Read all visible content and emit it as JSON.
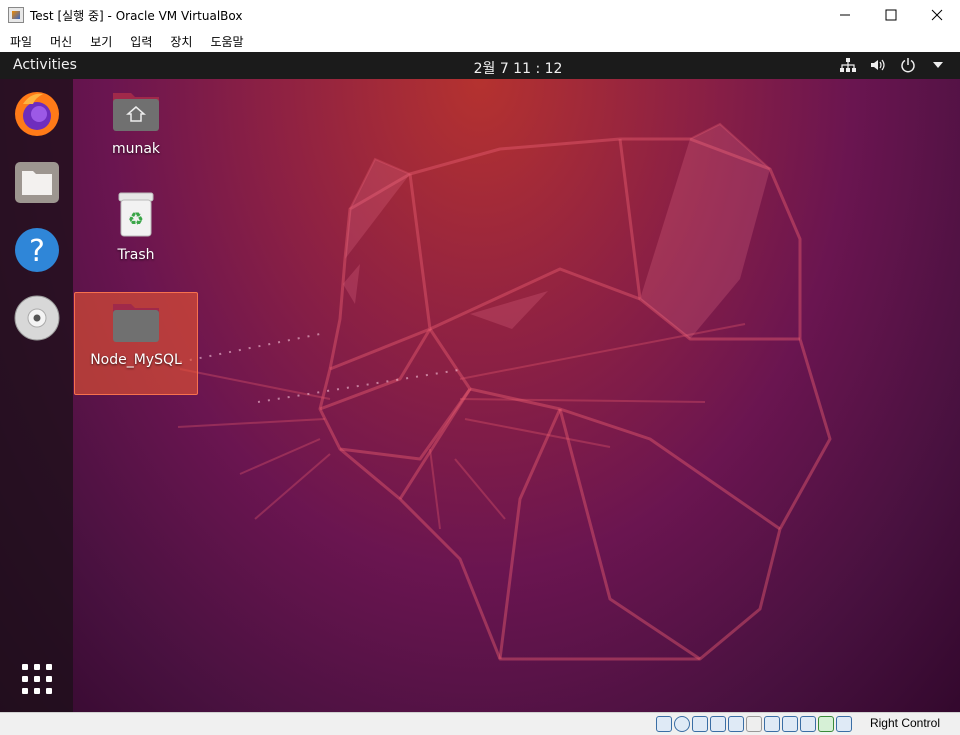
{
  "window": {
    "title": "Test [실행 중] - Oracle VM VirtualBox",
    "controls": [
      "minimize-icon",
      "maximize-icon",
      "close-icon"
    ]
  },
  "menu": [
    "파일",
    "머신",
    "보기",
    "입력",
    "장치",
    "도움말"
  ],
  "guest": {
    "topbar": {
      "activities": "Activities",
      "clock": "2월 7  11 : 12",
      "tray_icons": [
        "network-icon",
        "volume-icon",
        "power-icon",
        "chevron-down-icon"
      ]
    },
    "dock": [
      "firefox-icon",
      "files-icon",
      "help-icon",
      "disc-icon",
      "app-grid-icon"
    ],
    "desktop_icons": [
      {
        "label": "munak",
        "icon": "home-folder-icon"
      },
      {
        "label": "Trash",
        "icon": "trash-icon"
      },
      {
        "label": "Node_MySQL",
        "icon": "folder-icon",
        "selected": true
      }
    ]
  },
  "statusbar": {
    "host_key": "Right Control",
    "icons": [
      "hard-disk-icon",
      "optical-drive-icon",
      "audio-icon",
      "network-adapter-icon",
      "usb-icon",
      "shared-folder-icon",
      "display-icon",
      "recording-icon",
      "cpu-icon",
      "mouse-integration-icon",
      "keyboard-icon"
    ]
  },
  "colors": {
    "selection": "#e65432",
    "topbar": "#1b1b1b",
    "wallpaper_top": "#b5322f",
    "wallpaper_bottom": "#33082d"
  }
}
